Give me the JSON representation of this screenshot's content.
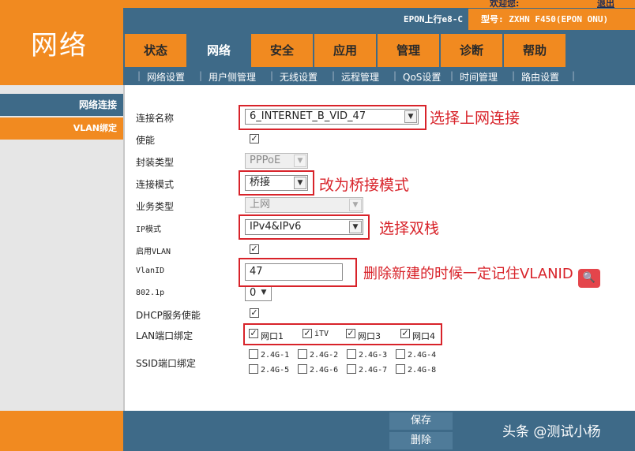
{
  "header": {
    "section_title": "网络",
    "welcome": "欢迎您:",
    "logout": "退出",
    "device_line": "EPON上行e8-C",
    "model": "型号: ZXHN F450(EPON ONU)"
  },
  "tabs": [
    "状态",
    "网络",
    "安全",
    "应用",
    "管理",
    "诊断",
    "帮助"
  ],
  "active_tab": "网络",
  "subtabs": [
    "网络设置",
    "用户侧管理",
    "无线设置",
    "远程管理",
    "QoS设置",
    "时间管理",
    "路由设置"
  ],
  "sidebar": {
    "items": [
      "网络连接",
      "VLAN绑定"
    ]
  },
  "form": {
    "conn_name_label": "连接名称",
    "conn_name_value": "6_INTERNET_B_VID_47",
    "enable_label": "使能",
    "encap_label": "封装类型",
    "encap_value": "PPPoE",
    "mode_label": "连接模式",
    "mode_value": "桥接",
    "service_label": "业务类型",
    "service_value": "上网",
    "ip_mode_label": "IP模式",
    "ip_mode_value": "IPv4&IPv6",
    "vlan_enable_label": "启用VLAN",
    "vlanid_label": "VlanID",
    "vlanid_value": "47",
    "dot1p_label": "802.1p",
    "dot1p_value": "0",
    "dhcp_label": "DHCP服务使能",
    "lan_bind_label": "LAN端口绑定",
    "lan_ports": [
      "网口1",
      "iTV",
      "网口3",
      "网口4"
    ],
    "ssid_bind_label": "SSID端口绑定",
    "ssid_ports": [
      "2.4G-1",
      "2.4G-2",
      "2.4G-3",
      "2.4G-4",
      "2.4G-5",
      "2.4G-6",
      "2.4G-7",
      "2.4G-8"
    ]
  },
  "annotations": {
    "conn": "选择上网连接",
    "mode": "改为桥接模式",
    "ip": "选择双栈",
    "vlan": "删除新建的时候一定记住VLANID"
  },
  "footer": {
    "save": "保存",
    "delete": "删除",
    "watermark": "头条 @测试小杨"
  },
  "check_mark": "✓",
  "arrow_glyph": "▼",
  "search_glyph": "🔍"
}
